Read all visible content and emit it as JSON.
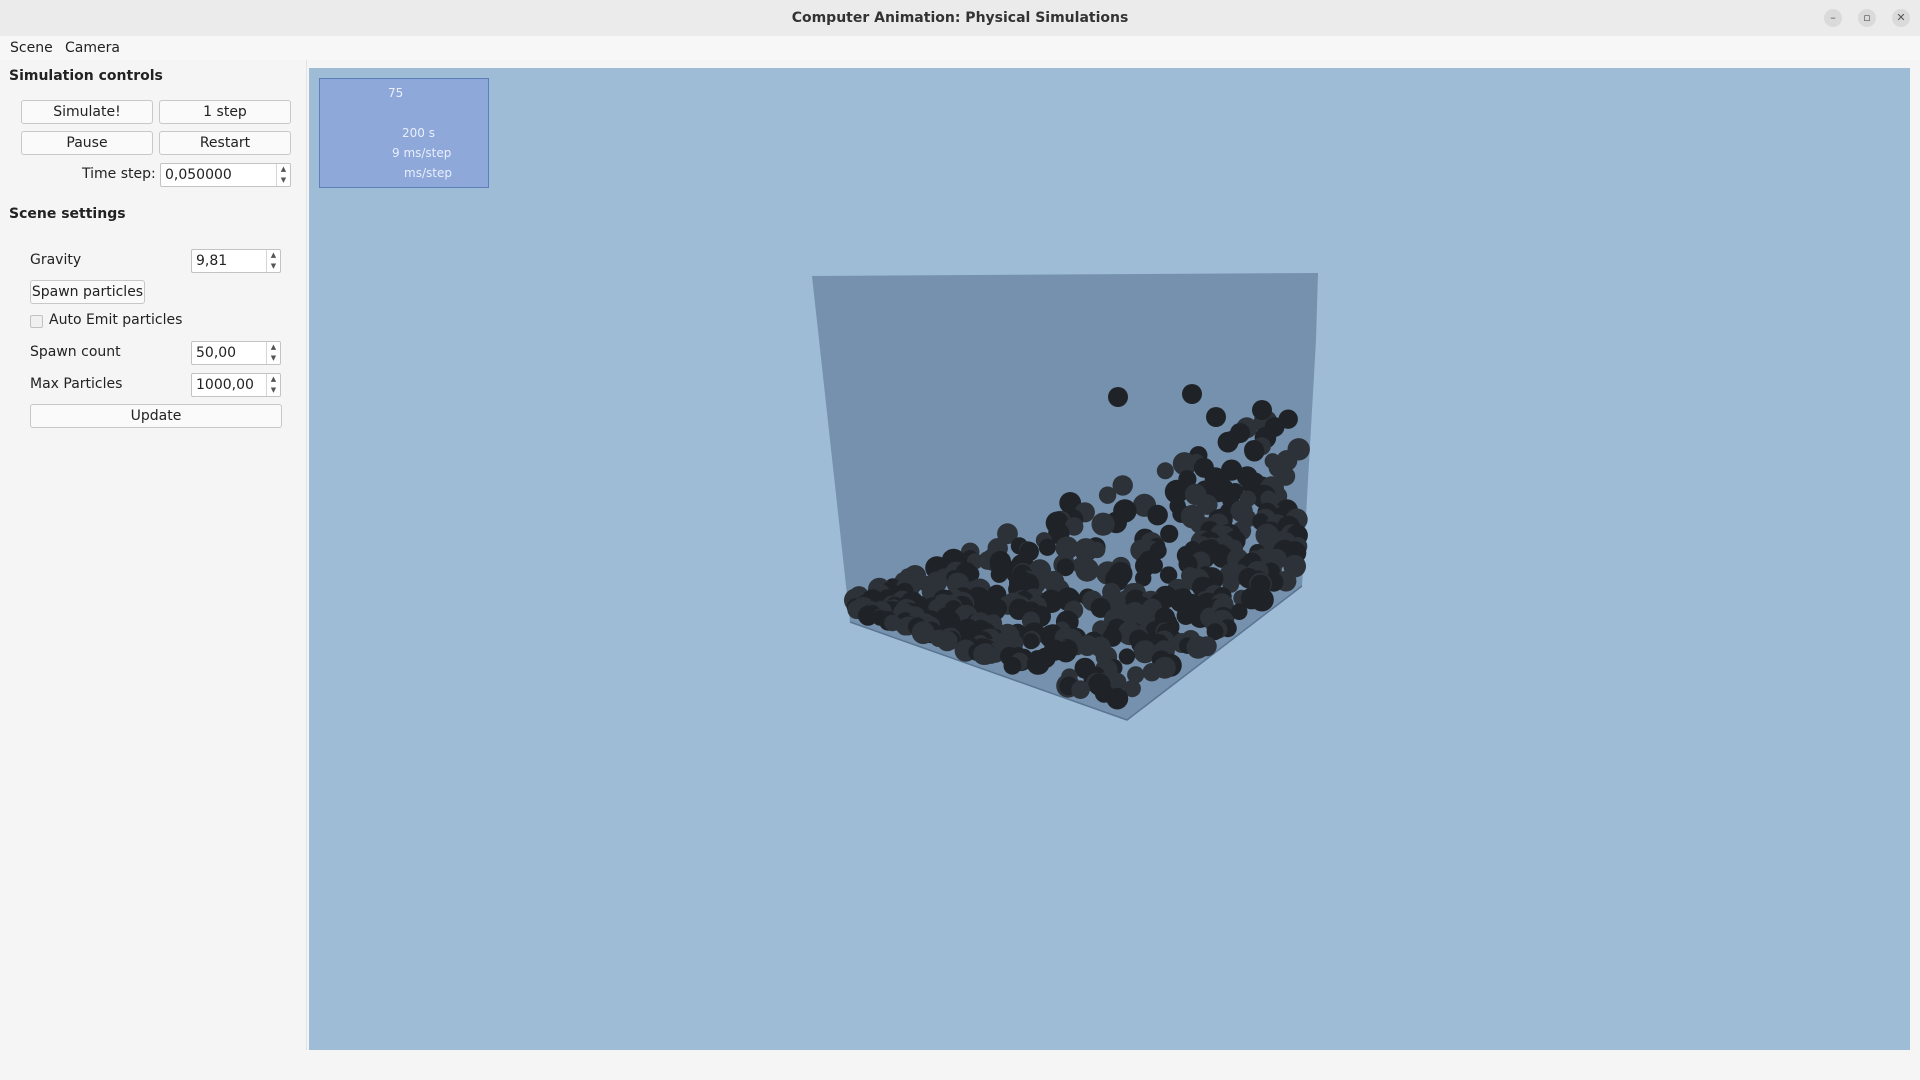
{
  "window": {
    "title": "Computer Animation: Physical Simulations"
  },
  "menu": {
    "scene": "Scene",
    "camera": "Camera"
  },
  "simulation_controls": {
    "title": "Simulation controls",
    "simulate_label": "Simulate!",
    "step_label": "1 step",
    "pause_label": "Pause",
    "restart_label": "Restart",
    "timestep_label": "Time step:",
    "timestep_value": "0,050000"
  },
  "scene_settings": {
    "title": "Scene settings",
    "gravity_label": "Gravity",
    "gravity_value": "9,81",
    "spawn_particles_label": "Spawn particles",
    "auto_emit_label": "Auto Emit particles",
    "auto_emit_checked": false,
    "spawn_count_label": "Spawn count",
    "spawn_count_value": "50,00",
    "max_particles_label": "Max Particles",
    "max_particles_value": "1000,00",
    "update_label": "Update"
  },
  "stats_overlay": {
    "line1": "75",
    "line2": "200 s",
    "line3": "9 ms/step",
    "line4": "ms/step"
  },
  "colors": {
    "viewport_bg": "#9fbcd6",
    "box_fill": "#6d8aa6",
    "particle": "#1f2327",
    "overlay_bg": "#8ea8da"
  }
}
